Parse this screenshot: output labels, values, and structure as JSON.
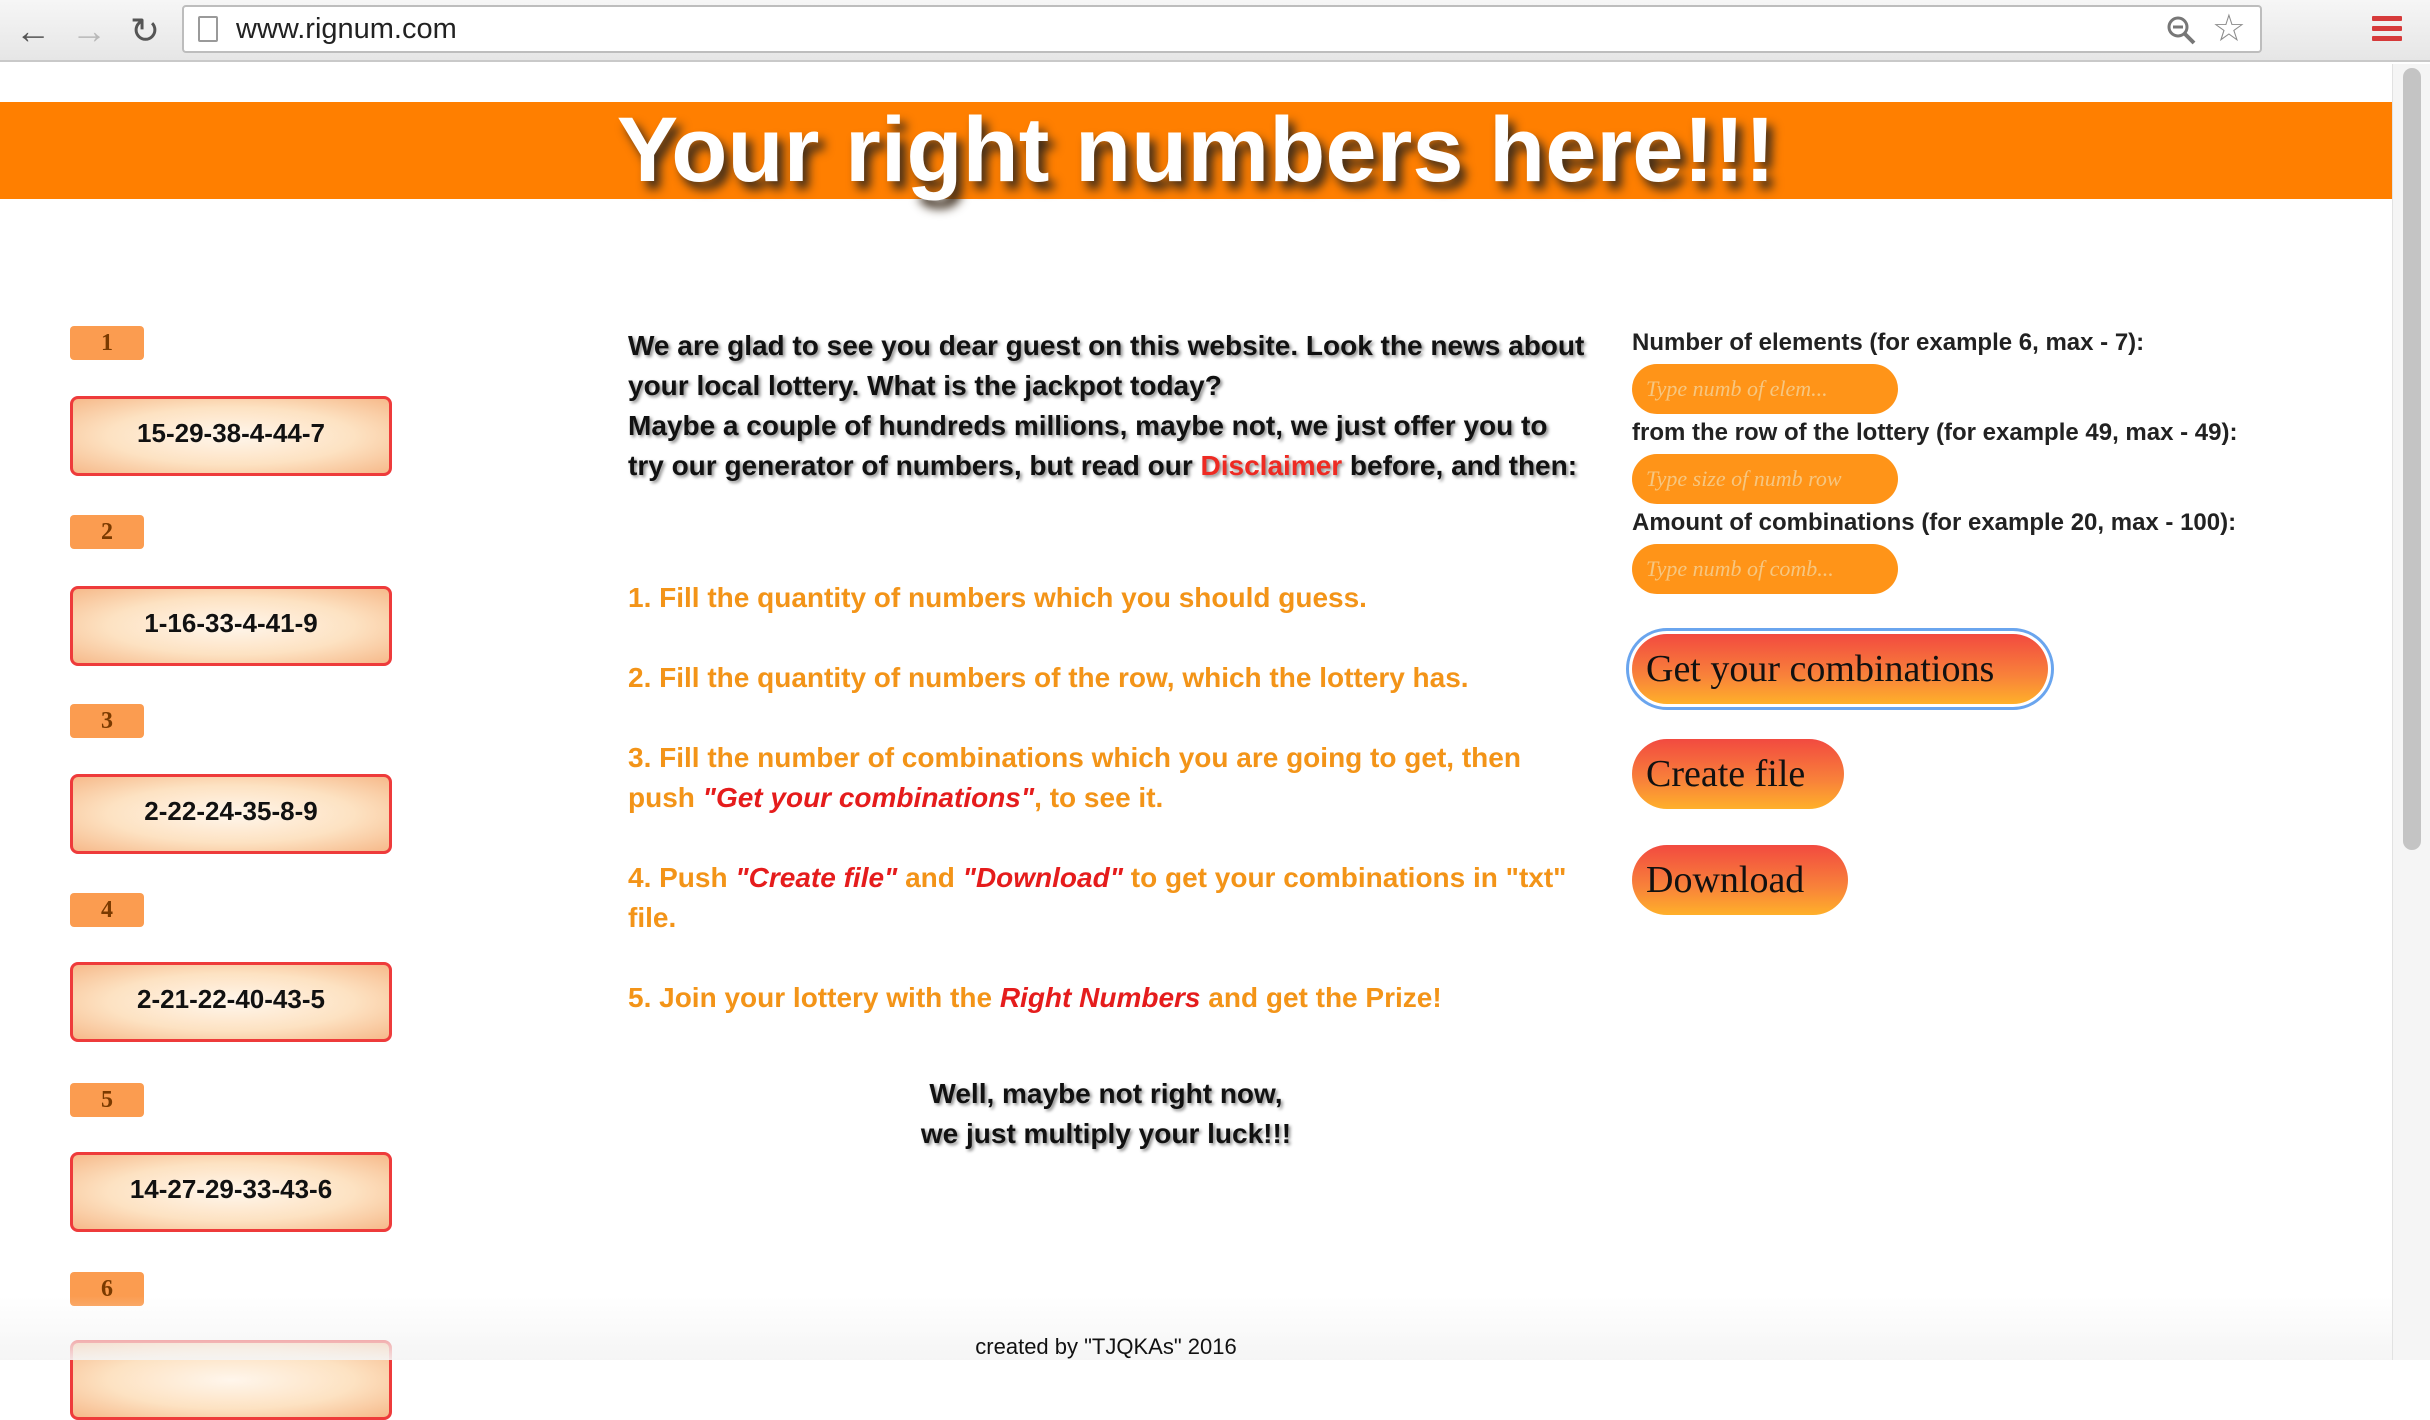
{
  "browser": {
    "url": "www.rignum.com",
    "icons": {
      "back": "arrow-left-icon",
      "forward": "arrow-right-icon",
      "reload": "reload-icon",
      "zoom": "zoom-icon",
      "bookmark": "star-icon",
      "menu": "menu-icon"
    }
  },
  "colors": {
    "banner": "#ff7f00",
    "accent_red": "#ee3b3b",
    "step_orange": "#f39418",
    "input_orange": "#ff9418"
  },
  "banner": {
    "title": "Your right numbers here!!!"
  },
  "combinations": [
    {
      "index": "1",
      "numbers": "15-29-38-4-44-7"
    },
    {
      "index": "2",
      "numbers": "1-16-33-4-41-9"
    },
    {
      "index": "3",
      "numbers": "2-22-24-35-8-9"
    },
    {
      "index": "4",
      "numbers": "2-21-22-40-43-5"
    },
    {
      "index": "5",
      "numbers": "14-27-29-33-43-6"
    },
    {
      "index": "6",
      "numbers": ""
    }
  ],
  "intro": {
    "line1": "We are glad to see you dear guest on this website. Look the news about your local lottery. What is the jackpot today?",
    "line2_before": "Maybe a couple of hundreds millions, maybe not, we just offer you to try our generator of numbers, but read our ",
    "disclaimer_link": "Disclaimer",
    "line2_after": " before, and then:"
  },
  "steps": {
    "s1": "1. Fill the quantity of numbers which you should guess.",
    "s2": "2. Fill the quantity of numbers of the row, which the lottery has.",
    "s3_before": "3. Fill the number of combinations which you are going to get, then push ",
    "s3_highlight": "\"Get your combinations\"",
    "s3_after": ", to see it.",
    "s4_before": "4. Push ",
    "s4_highlight1": "\"Create file\"",
    "s4_mid": " and ",
    "s4_highlight2": "\"Download\"",
    "s4_after": " to get your combinations in \"txt\" file.",
    "s5_before": "5. Join your lottery with the ",
    "s5_highlight": "Right Numbers",
    "s5_after": " and get the Prize!"
  },
  "closing": {
    "line1": "Well, maybe not right now,",
    "line2": "we just multiply your luck!!!"
  },
  "form": {
    "elements_label": "Number of elements (for example 6, max - 7):",
    "elements_placeholder": "Type numb of elem...",
    "row_label": "from the row of the lottery (for example 49, max - 49):",
    "row_placeholder": "Type size of numb row",
    "amount_label": "Amount of combinations (for example 20, max - 100):",
    "amount_placeholder": "Type numb of comb...",
    "get_button": "Get your combinations",
    "create_button": "Create file",
    "download_button": "Download"
  },
  "footer": {
    "text": "created by \"TJQKAs\" 2016"
  }
}
